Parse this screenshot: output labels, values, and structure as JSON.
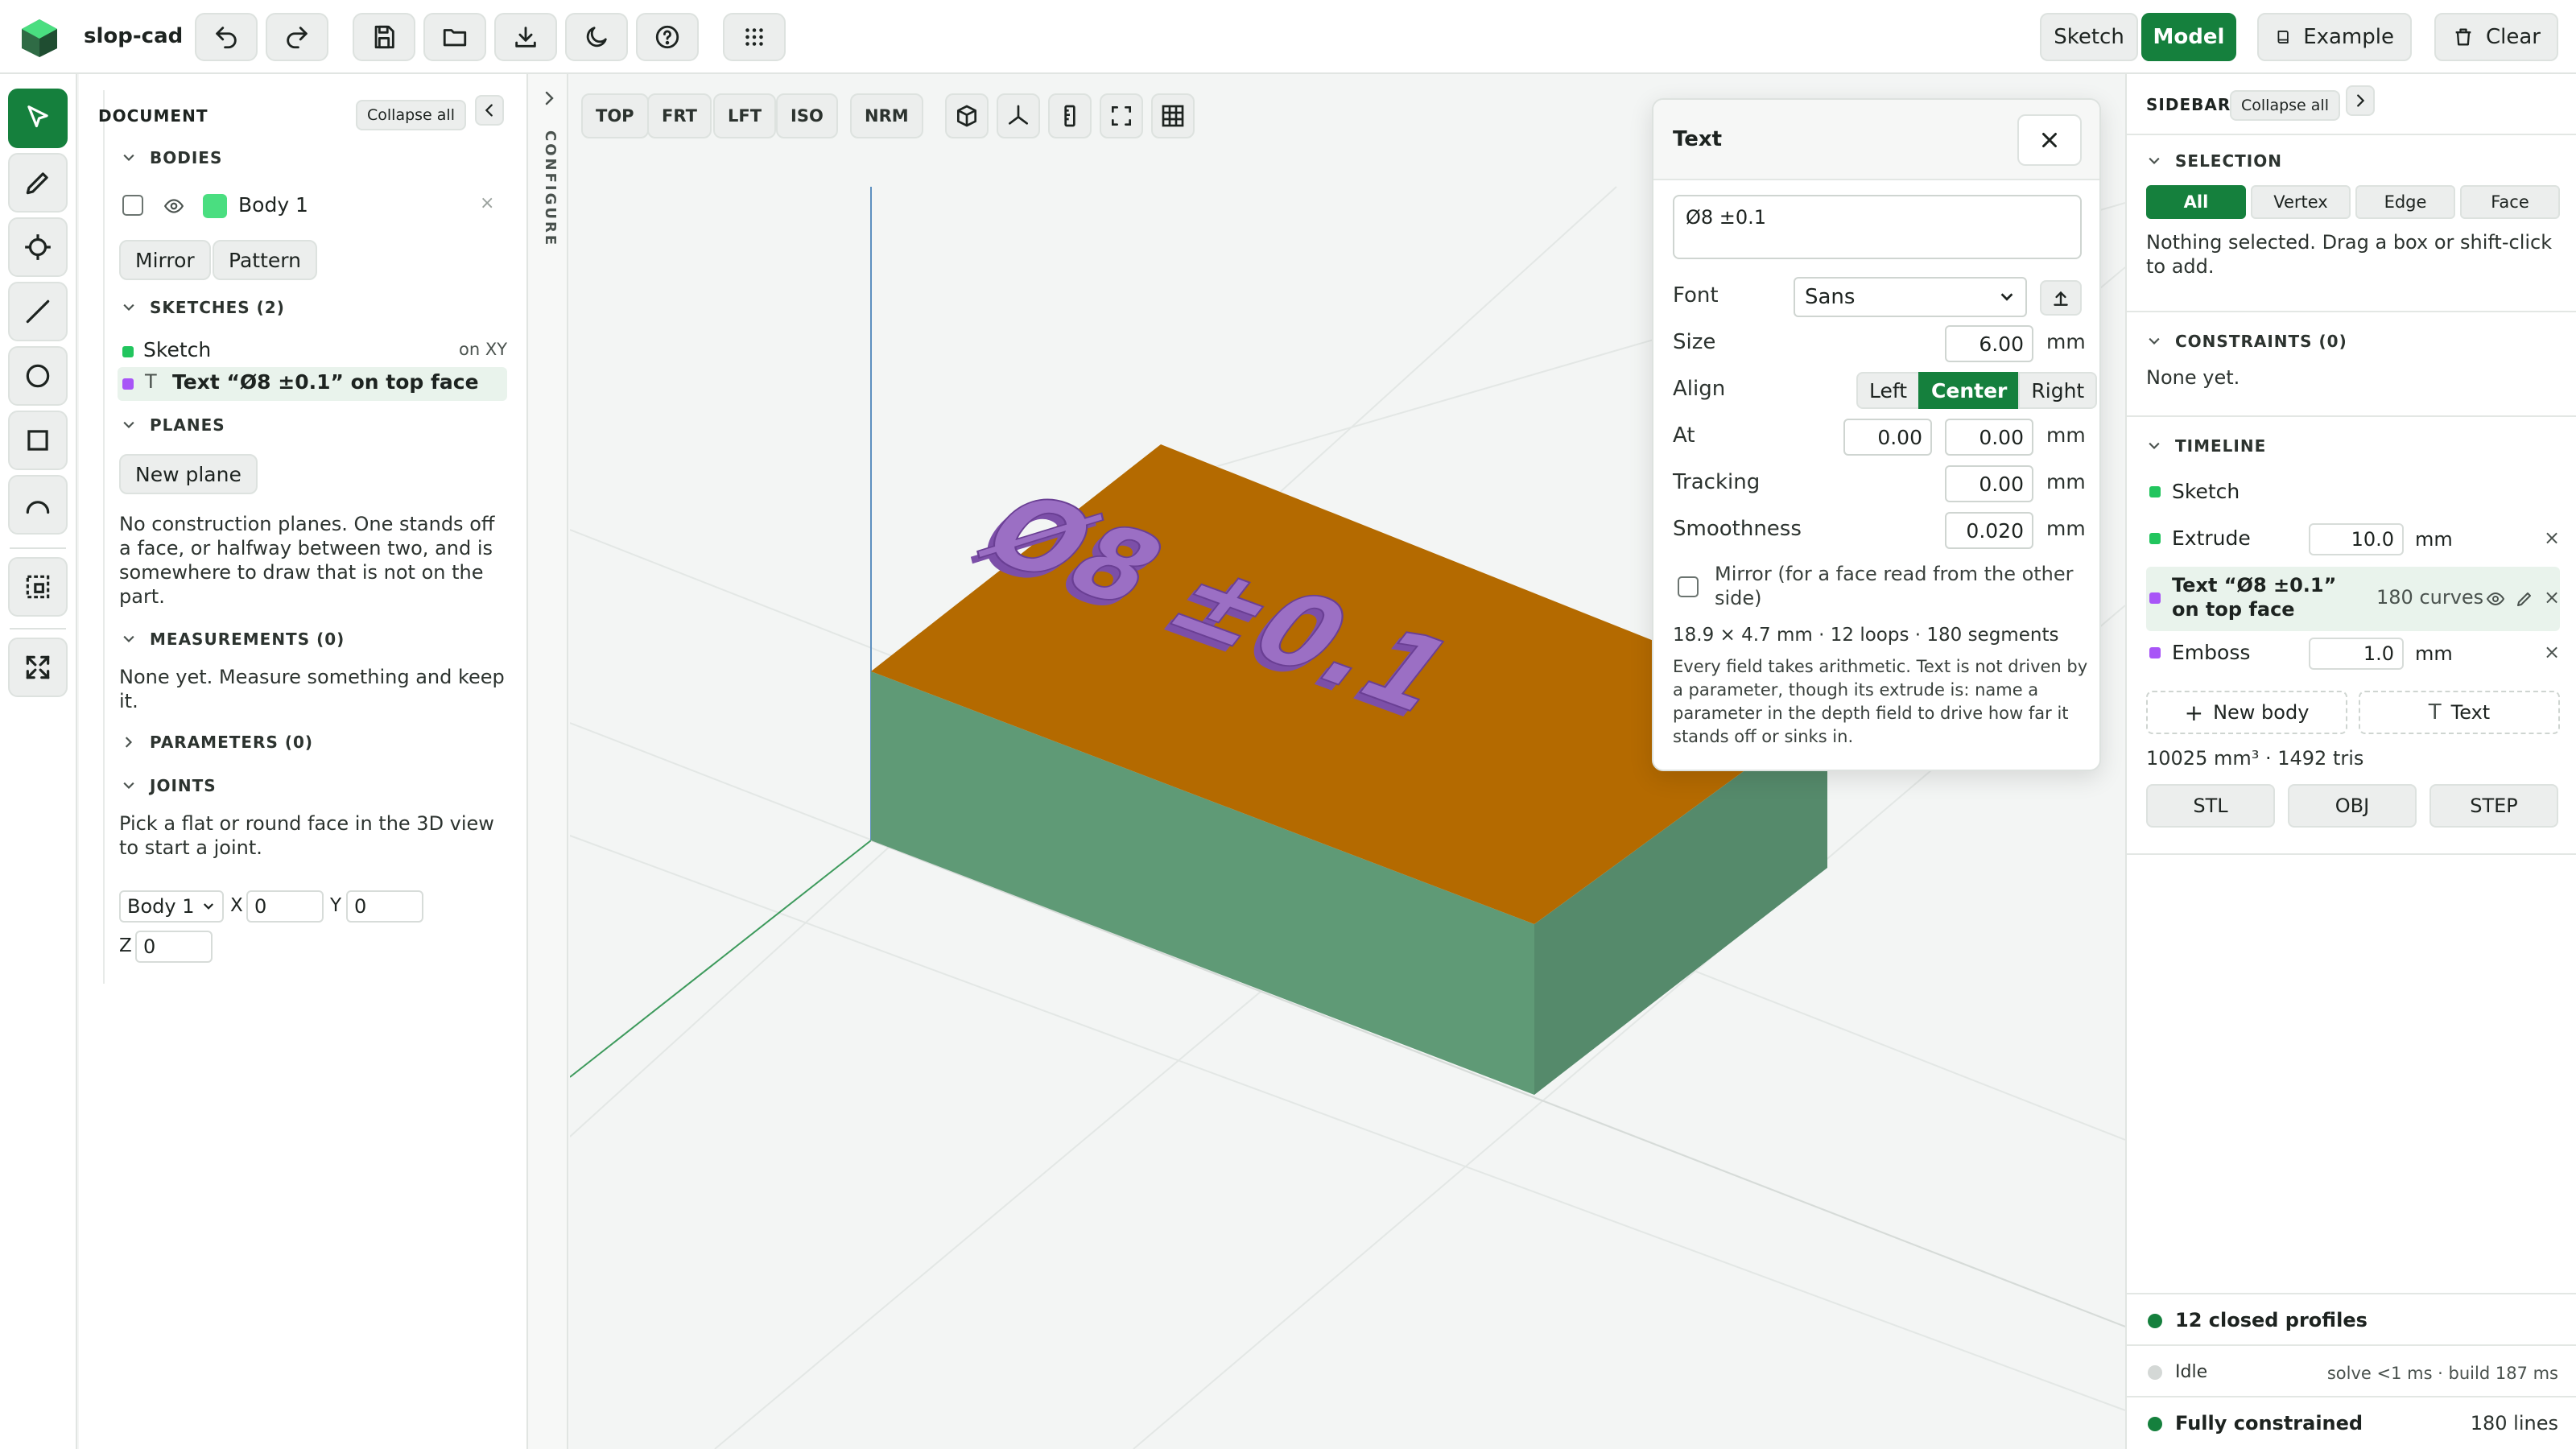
{
  "app": {
    "name": "slop-cad"
  },
  "header": {
    "sketch_label": "Sketch",
    "model_label": "Model",
    "example_label": "Example",
    "clear_label": "Clear"
  },
  "document": {
    "title": "DOCUMENT",
    "collapse_all": "Collapse all",
    "bodies": {
      "title": "BODIES",
      "items": [
        {
          "name": "Body 1",
          "color": "#4ade80"
        }
      ],
      "mirror": "Mirror",
      "pattern": "Pattern"
    },
    "sketches": {
      "title": "SKETCHES (2)",
      "items": [
        {
          "label": "Sketch",
          "meta": "on XY",
          "color": "#22c55e"
        },
        {
          "label": "Text “Ø8 ±0.1” on top face",
          "color": "#a855f7"
        }
      ]
    },
    "planes": {
      "title": "PLANES",
      "new_plane": "New plane",
      "description": "No construction planes. One stands off a face, or halfway between two, and is somewhere to draw that is not on the part."
    },
    "measurements": {
      "title": "MEASUREMENTS (0)",
      "description": "None yet. Measure something and keep it."
    },
    "parameters": {
      "title": "PARAMETERS (0)"
    },
    "joints": {
      "title": "JOINTS",
      "description": "Pick a flat or round face in the 3D view to start a joint.",
      "body_select": "Body 1",
      "x_label": "X",
      "x_value": "0",
      "y_label": "Y",
      "y_value": "0",
      "z_label": "Z",
      "z_value": "0"
    }
  },
  "configure": {
    "label": "CONFIGURE"
  },
  "viewport": {
    "views": [
      "TOP",
      "FRT",
      "LFT",
      "ISO",
      "NRM"
    ],
    "colors": {
      "top_face": "#b46a00",
      "side_face": "#5f9a76",
      "emboss": "#9b6fc4"
    }
  },
  "text_dialog": {
    "title": "Text",
    "text_value": "Ø8 ±0.1",
    "font_label": "Font",
    "font_value": "Sans",
    "size_label": "Size",
    "size_value": "6.00",
    "unit": "mm",
    "align_label": "Align",
    "align_options": [
      "Left",
      "Center",
      "Right"
    ],
    "align_selected": "Center",
    "at_label": "At",
    "at_x": "0.00",
    "at_y": "0.00",
    "tracking_label": "Tracking",
    "tracking_value": "0.00",
    "smoothness_label": "Smoothness",
    "smoothness_value": "0.020",
    "mirror_label": "Mirror (for a face read from the other side)",
    "stats": "18.9 × 4.7 mm · 12 loops · 180 segments",
    "note": "Every field takes arithmetic. Text is not driven by a parameter, though its extrude is: name a parameter in the depth field to drive how far it stands off or sinks in."
  },
  "sidebar": {
    "title": "SIDEBAR",
    "collapse_all": "Collapse all",
    "selection": {
      "title": "SELECTION",
      "modes": [
        "All",
        "Vertex",
        "Edge",
        "Face"
      ],
      "selected_mode": "All",
      "description": "Nothing selected. Drag a box or shift-click to add."
    },
    "constraints": {
      "title": "CONSTRAINTS (0)",
      "description": "None yet."
    },
    "timeline": {
      "title": "TIMELINE",
      "items": [
        {
          "label": "Sketch",
          "color": "#22c55e"
        },
        {
          "label": "Extrude",
          "value": "10.0",
          "unit": "mm",
          "color": "#22c55e"
        },
        {
          "label": "Text “Ø8 ±0.1” on top face",
          "meta": "180 curves",
          "color": "#a855f7"
        },
        {
          "label": "Emboss",
          "value": "1.0",
          "unit": "mm",
          "color": "#a855f7"
        }
      ],
      "new_body": "New body",
      "text_button": "Text"
    },
    "stats": "10025 mm³ · 1492 tris",
    "exports": [
      "STL",
      "OBJ",
      "STEP"
    ],
    "status": [
      {
        "label": "12 closed profiles",
        "color": "#15803d"
      },
      {
        "label": "Idle",
        "detail": "solve <1 ms · build 187 ms",
        "color": "#d4d8d6"
      },
      {
        "label": "Fully constrained",
        "detail": "180 lines",
        "color": "#15803d"
      }
    ]
  }
}
